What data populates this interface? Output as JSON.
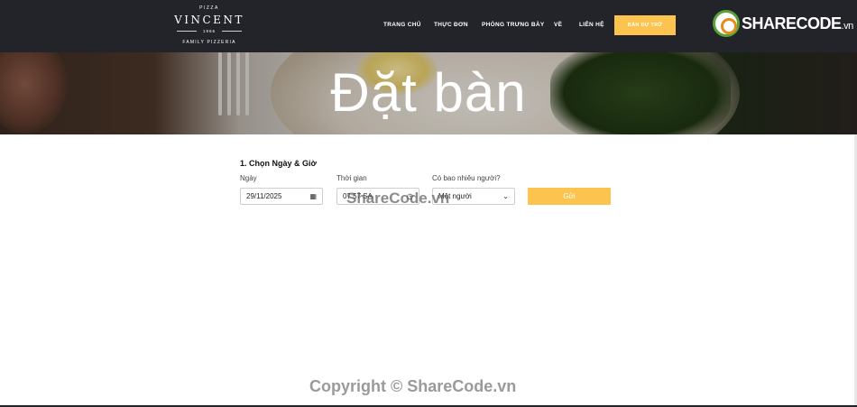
{
  "logo": {
    "top": "PIZZA",
    "name": "VINCENT",
    "year": "1966",
    "sub": "FAMILY PIZZERIA"
  },
  "nav": {
    "items": [
      "TRANG CHỦ",
      "THỰC ĐƠN",
      "PHÒNG TRƯNG BÀY",
      "VỀ",
      "LIÊN HỆ"
    ],
    "cta": "BÀN DỰ TRỮ"
  },
  "brand": {
    "name": "SHARECODE",
    "tld": ".vn"
  },
  "hero": {
    "title": "Đặt bàn"
  },
  "form": {
    "section_title": "1. Chọn Ngày & Giờ",
    "date": {
      "label": "Ngày",
      "value": "29/11/2025"
    },
    "time": {
      "label": "Thời gian",
      "value": "07:57 SA"
    },
    "people": {
      "label": "Có bao nhiêu người?",
      "value": "Một người"
    },
    "submit_label": "Gửi"
  },
  "watermarks": {
    "middle": "ShareCode.vn",
    "bottom": "Copyright © ShareCode.vn"
  },
  "colors": {
    "header_bg": "#23232a",
    "accent": "#fcc44e"
  }
}
